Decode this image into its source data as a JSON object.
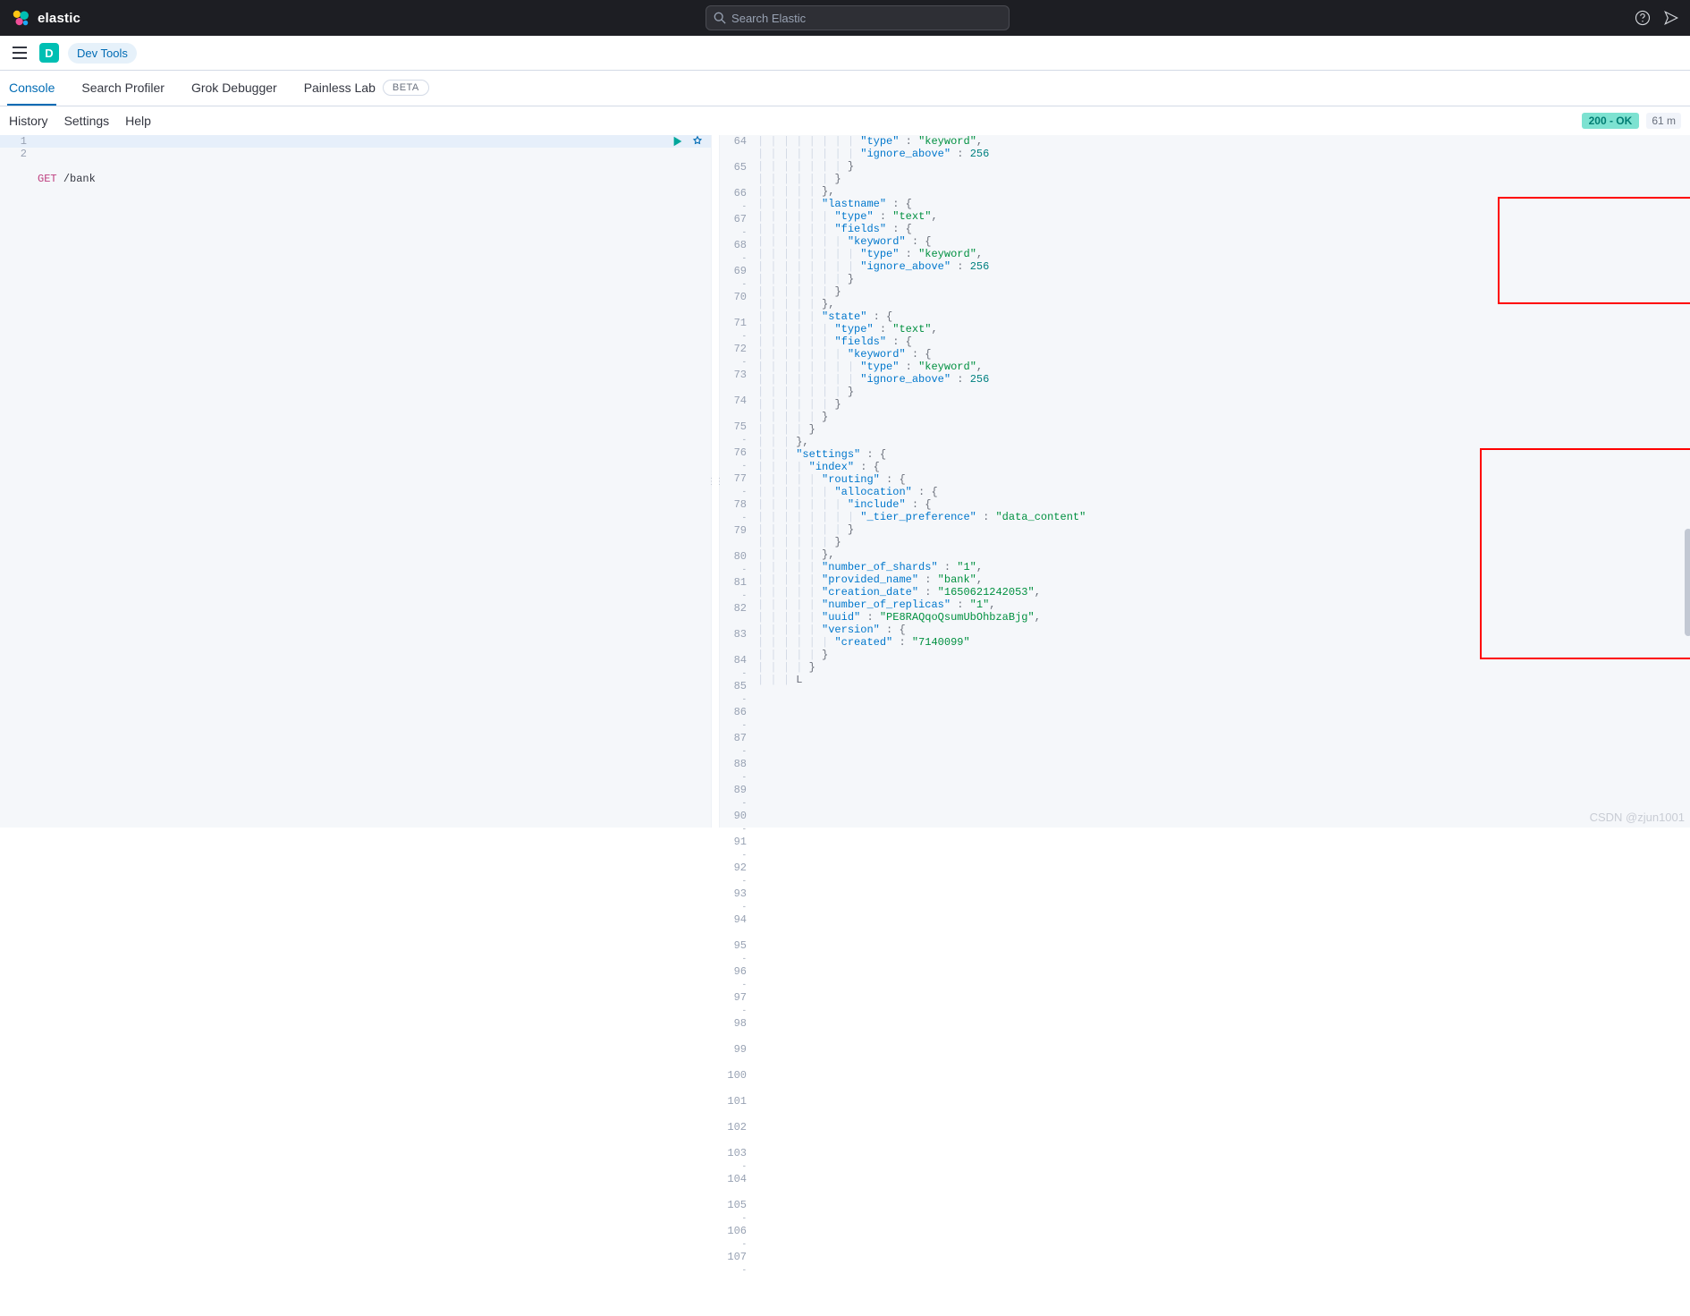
{
  "header": {
    "brand": "elastic",
    "search_placeholder": "Search Elastic"
  },
  "nav": {
    "app_letter": "D",
    "breadcrumb": "Dev Tools"
  },
  "tabs": {
    "console": "Console",
    "profiler": "Search Profiler",
    "grok": "Grok Debugger",
    "painless": "Painless Lab",
    "beta": "BETA"
  },
  "subbar": {
    "history": "History",
    "settings": "Settings",
    "help": "Help",
    "status": "200 - OK",
    "timing": "61 m"
  },
  "request": {
    "line1_num": "1",
    "line2_num": "2",
    "method": "GET",
    "path": "/bank"
  },
  "response": {
    "lines": [
      {
        "n": "64",
        "i": 8,
        "t": [
          [
            "k",
            "\"type\""
          ],
          [
            "p",
            " : "
          ],
          [
            "s",
            "\"keyword\""
          ],
          [
            "p",
            ","
          ]
        ],
        "f": ""
      },
      {
        "n": "65",
        "i": 8,
        "t": [
          [
            "k",
            "\"ignore_above\""
          ],
          [
            "p",
            " : "
          ],
          [
            "n",
            "256"
          ]
        ],
        "f": ""
      },
      {
        "n": "66",
        "i": 7,
        "t": [
          [
            "p",
            "}"
          ]
        ],
        "f": "-"
      },
      {
        "n": "67",
        "i": 6,
        "t": [
          [
            "p",
            "}"
          ]
        ],
        "f": "-"
      },
      {
        "n": "68",
        "i": 5,
        "t": [
          [
            "p",
            "},"
          ]
        ],
        "f": "-"
      },
      {
        "n": "69",
        "i": 5,
        "t": [
          [
            "k",
            "\"lastname\""
          ],
          [
            "p",
            " : {"
          ]
        ],
        "f": "-"
      },
      {
        "n": "70",
        "i": 6,
        "t": [
          [
            "k",
            "\"type\""
          ],
          [
            "p",
            " : "
          ],
          [
            "s",
            "\"text\""
          ],
          [
            "p",
            ","
          ]
        ],
        "f": ""
      },
      {
        "n": "71",
        "i": 6,
        "t": [
          [
            "k",
            "\"fields\""
          ],
          [
            "p",
            " : {"
          ]
        ],
        "f": "-"
      },
      {
        "n": "72",
        "i": 7,
        "t": [
          [
            "k",
            "\"keyword\""
          ],
          [
            "p",
            " : {"
          ]
        ],
        "f": "-"
      },
      {
        "n": "73",
        "i": 8,
        "t": [
          [
            "k",
            "\"type\""
          ],
          [
            "p",
            " : "
          ],
          [
            "s",
            "\"keyword\""
          ],
          [
            "p",
            ","
          ]
        ],
        "f": ""
      },
      {
        "n": "74",
        "i": 8,
        "t": [
          [
            "k",
            "\"ignore_above\""
          ],
          [
            "p",
            " : "
          ],
          [
            "n",
            "256"
          ]
        ],
        "f": ""
      },
      {
        "n": "75",
        "i": 7,
        "t": [
          [
            "p",
            "}"
          ]
        ],
        "f": "-"
      },
      {
        "n": "76",
        "i": 6,
        "t": [
          [
            "p",
            "}"
          ]
        ],
        "f": "-"
      },
      {
        "n": "77",
        "i": 5,
        "t": [
          [
            "p",
            "},"
          ]
        ],
        "f": "-"
      },
      {
        "n": "78",
        "i": 5,
        "t": [
          [
            "k",
            "\"state\""
          ],
          [
            "p",
            " : {"
          ]
        ],
        "f": "-"
      },
      {
        "n": "79",
        "i": 6,
        "t": [
          [
            "k",
            "\"type\""
          ],
          [
            "p",
            " : "
          ],
          [
            "s",
            "\"text\""
          ],
          [
            "p",
            ","
          ]
        ],
        "f": ""
      },
      {
        "n": "80",
        "i": 6,
        "t": [
          [
            "k",
            "\"fields\""
          ],
          [
            "p",
            " : {"
          ]
        ],
        "f": "-"
      },
      {
        "n": "81",
        "i": 7,
        "t": [
          [
            "k",
            "\"keyword\""
          ],
          [
            "p",
            " : {"
          ]
        ],
        "f": "-"
      },
      {
        "n": "82",
        "i": 8,
        "t": [
          [
            "k",
            "\"type\""
          ],
          [
            "p",
            " : "
          ],
          [
            "s",
            "\"keyword\""
          ],
          [
            "p",
            ","
          ]
        ],
        "f": ""
      },
      {
        "n": "83",
        "i": 8,
        "t": [
          [
            "k",
            "\"ignore_above\""
          ],
          [
            "p",
            " : "
          ],
          [
            "n",
            "256"
          ]
        ],
        "f": ""
      },
      {
        "n": "84",
        "i": 7,
        "t": [
          [
            "p",
            "}"
          ]
        ],
        "f": "-"
      },
      {
        "n": "85",
        "i": 6,
        "t": [
          [
            "p",
            "}"
          ]
        ],
        "f": "-"
      },
      {
        "n": "86",
        "i": 5,
        "t": [
          [
            "p",
            "}"
          ]
        ],
        "f": "-"
      },
      {
        "n": "87",
        "i": 4,
        "t": [
          [
            "p",
            "}"
          ]
        ],
        "f": "-"
      },
      {
        "n": "88",
        "i": 3,
        "t": [
          [
            "p",
            "},"
          ]
        ],
        "f": "-"
      },
      {
        "n": "89",
        "i": 3,
        "t": [
          [
            "k",
            "\"settings\""
          ],
          [
            "p",
            " : {"
          ]
        ],
        "f": "-"
      },
      {
        "n": "90",
        "i": 4,
        "t": [
          [
            "k",
            "\"index\""
          ],
          [
            "p",
            " : {"
          ]
        ],
        "f": "-"
      },
      {
        "n": "91",
        "i": 5,
        "t": [
          [
            "k",
            "\"routing\""
          ],
          [
            "p",
            " : {"
          ]
        ],
        "f": "-"
      },
      {
        "n": "92",
        "i": 6,
        "t": [
          [
            "k",
            "\"allocation\""
          ],
          [
            "p",
            " : {"
          ]
        ],
        "f": "-"
      },
      {
        "n": "93",
        "i": 7,
        "t": [
          [
            "k",
            "\"include\""
          ],
          [
            "p",
            " : {"
          ]
        ],
        "f": "-"
      },
      {
        "n": "94",
        "i": 8,
        "t": [
          [
            "k",
            "\"_tier_preference\""
          ],
          [
            "p",
            " : "
          ],
          [
            "s",
            "\"data_content\""
          ]
        ],
        "f": ""
      },
      {
        "n": "95",
        "i": 7,
        "t": [
          [
            "p",
            "}"
          ]
        ],
        "f": "-"
      },
      {
        "n": "96",
        "i": 6,
        "t": [
          [
            "p",
            "}"
          ]
        ],
        "f": "-"
      },
      {
        "n": "97",
        "i": 5,
        "t": [
          [
            "p",
            "},"
          ]
        ],
        "f": "-"
      },
      {
        "n": "98",
        "i": 5,
        "t": [
          [
            "k",
            "\"number_of_shards\""
          ],
          [
            "p",
            " : "
          ],
          [
            "s",
            "\"1\""
          ],
          [
            "p",
            ","
          ]
        ],
        "f": ""
      },
      {
        "n": "99",
        "i": 5,
        "t": [
          [
            "k",
            "\"provided_name\""
          ],
          [
            "p",
            " : "
          ],
          [
            "s",
            "\"bank\""
          ],
          [
            "p",
            ","
          ]
        ],
        "f": ""
      },
      {
        "n": "100",
        "i": 5,
        "t": [
          [
            "k",
            "\"creation_date\""
          ],
          [
            "p",
            " : "
          ],
          [
            "s",
            "\"1650621242053\""
          ],
          [
            "p",
            ","
          ]
        ],
        "f": ""
      },
      {
        "n": "101",
        "i": 5,
        "t": [
          [
            "k",
            "\"number_of_replicas\""
          ],
          [
            "p",
            " : "
          ],
          [
            "s",
            "\"1\""
          ],
          [
            "p",
            ","
          ]
        ],
        "f": ""
      },
      {
        "n": "102",
        "i": 5,
        "t": [
          [
            "k",
            "\"uuid\""
          ],
          [
            "p",
            " : "
          ],
          [
            "s",
            "\"PE8RAQqoQsumUbOhbzaBjg\""
          ],
          [
            "p",
            ","
          ]
        ],
        "f": ""
      },
      {
        "n": "103",
        "i": 5,
        "t": [
          [
            "k",
            "\"version\""
          ],
          [
            "p",
            " : {"
          ]
        ],
        "f": "-"
      },
      {
        "n": "104",
        "i": 6,
        "t": [
          [
            "k",
            "\"created\""
          ],
          [
            "p",
            " : "
          ],
          [
            "s",
            "\"7140099\""
          ]
        ],
        "f": ""
      },
      {
        "n": "105",
        "i": 5,
        "t": [
          [
            "p",
            "}"
          ]
        ],
        "f": "-"
      },
      {
        "n": "106",
        "i": 4,
        "t": [
          [
            "p",
            "}"
          ]
        ],
        "f": "-"
      },
      {
        "n": "107",
        "i": 3,
        "t": [
          [
            "p",
            "L"
          ]
        ],
        "f": "-"
      }
    ]
  },
  "watermark": "CSDN @zjun1001"
}
